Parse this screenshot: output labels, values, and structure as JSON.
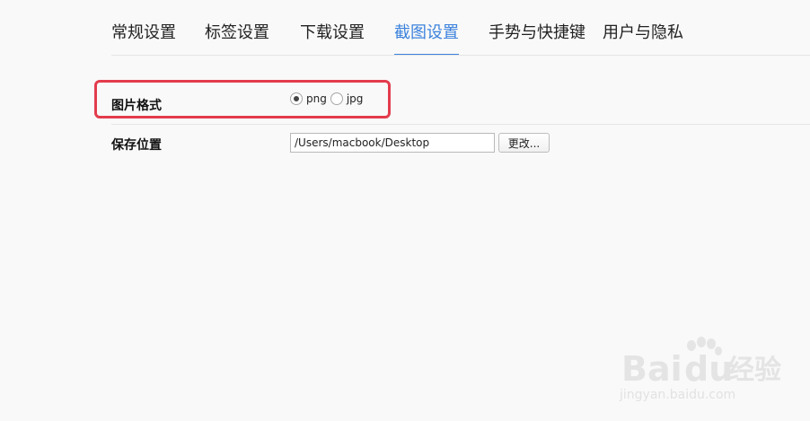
{
  "tabs": [
    {
      "label": "常规设置",
      "active": false
    },
    {
      "label": "标签设置",
      "active": false
    },
    {
      "label": "下载设置",
      "active": false
    },
    {
      "label": "截图设置",
      "active": true
    },
    {
      "label": "手势与快捷键",
      "active": false
    },
    {
      "label": "用户与隐私",
      "active": false
    }
  ],
  "image_format": {
    "label": "图片格式",
    "options": [
      {
        "label": "png",
        "checked": true
      },
      {
        "label": "jpg",
        "checked": false
      }
    ]
  },
  "save_location": {
    "label": "保存位置",
    "path": "/Users/macbook/Desktop",
    "change_label": "更改..."
  },
  "colors": {
    "accent": "#3c82dc",
    "highlight": "#e33c4d"
  },
  "watermark": {
    "brand": "Bai",
    "brand2": "du",
    "sub": "经验",
    "url": "jingyan.baidu.com"
  }
}
